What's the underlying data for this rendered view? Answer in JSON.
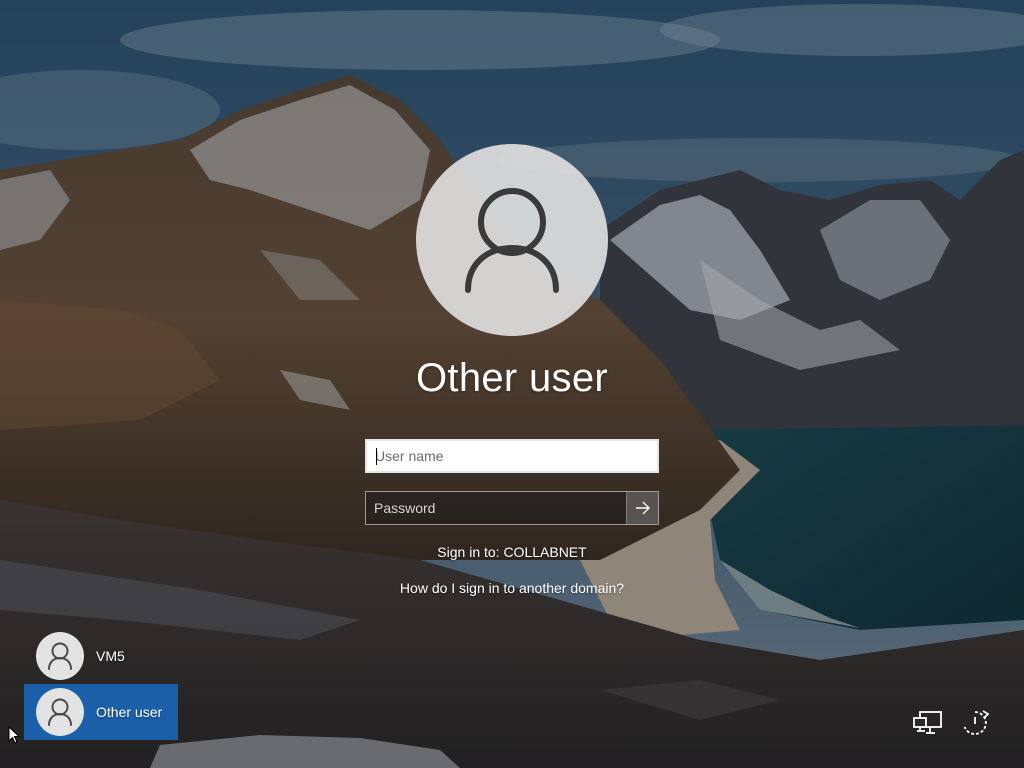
{
  "login": {
    "selected_user": "Other user",
    "username_placeholder": "User name",
    "username_value": "",
    "password_placeholder": "Password",
    "password_value": "",
    "submit_icon": "arrow-right-icon",
    "sign_in_to": "Sign in to: COLLABNET",
    "domain_help_link": "How do I sign in to another domain?"
  },
  "user_list": [
    {
      "name": "VM5",
      "icon": "user-avatar-icon",
      "selected": false
    },
    {
      "name": "Other user",
      "icon": "user-avatar-icon",
      "selected": true
    }
  ],
  "tray": {
    "network_icon": "network-icon",
    "power_icon": "power-icon"
  },
  "colors": {
    "selected_user_bg": "#1a5fa8",
    "text": "#ffffff"
  }
}
